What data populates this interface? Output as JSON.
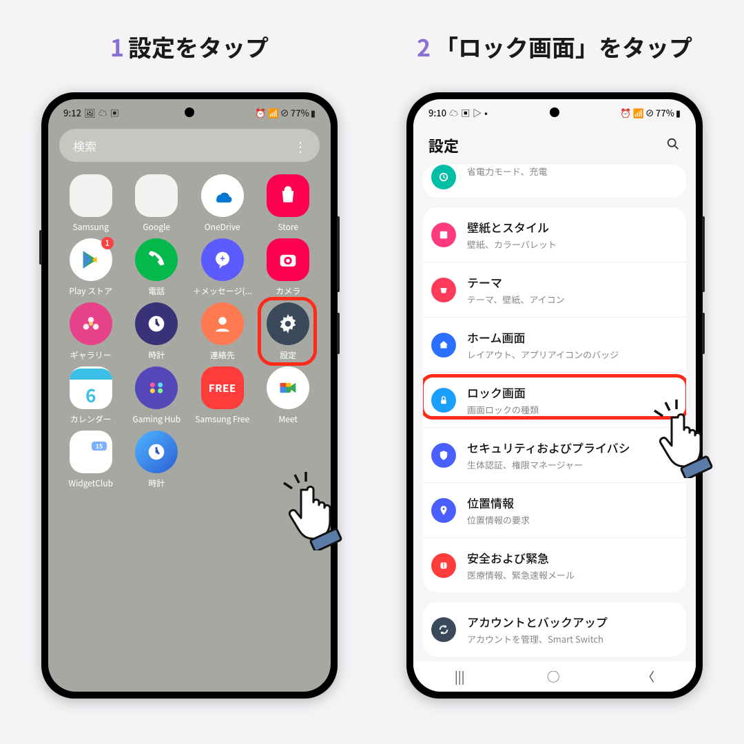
{
  "steps": {
    "s1": {
      "num": "1",
      "title": "設定をタップ"
    },
    "s2": {
      "num": "2",
      "title": "「ロック画面」をタップ"
    }
  },
  "status": {
    "time1": "9:12",
    "time2": "9:10",
    "battery": "77%"
  },
  "search": {
    "placeholder": "検索"
  },
  "apps": {
    "samsung": "Samsung",
    "google": "Google",
    "onedrive": "OneDrive",
    "store": "Store",
    "playstore": "Play ストア",
    "phone": "電話",
    "plusmsg": "＋メッセージ(...",
    "camera": "カメラ",
    "gallery": "ギャラリー",
    "clock": "時計",
    "contacts": "連絡先",
    "settings": "設定",
    "calendar": "カレンダー",
    "gaminghub": "Gaming Hub",
    "samsungfree": "Samsung Free",
    "meet": "Meet",
    "widgetclub": "WidgetClub",
    "clock2": "時計",
    "playstore_badge": "1",
    "calendar_day": "6",
    "free_text": "FREE"
  },
  "settings": {
    "title": "設定",
    "battery_sub": "省電力モード、充電",
    "wallpaper": "壁紙とスタイル",
    "wallpaper_sub": "壁紙、カラーパレット",
    "theme": "テーマ",
    "theme_sub": "テーマ、壁紙、アイコン",
    "home": "ホーム画面",
    "home_sub": "レイアウト、アプリアイコンのバッジ",
    "lock": "ロック画面",
    "lock_sub": "画面ロックの種類",
    "security": "セキュリティおよびプライバシ",
    "security_sub": "生体認証、権限マネージャー",
    "location": "位置情報",
    "location_sub": "位置情報の要求",
    "safety": "安全および緊急",
    "safety_sub": "医療情報、緊急速報メール",
    "account": "アカウントとバックアップ",
    "account_sub": "アカウントを管理、Smart Switch"
  }
}
